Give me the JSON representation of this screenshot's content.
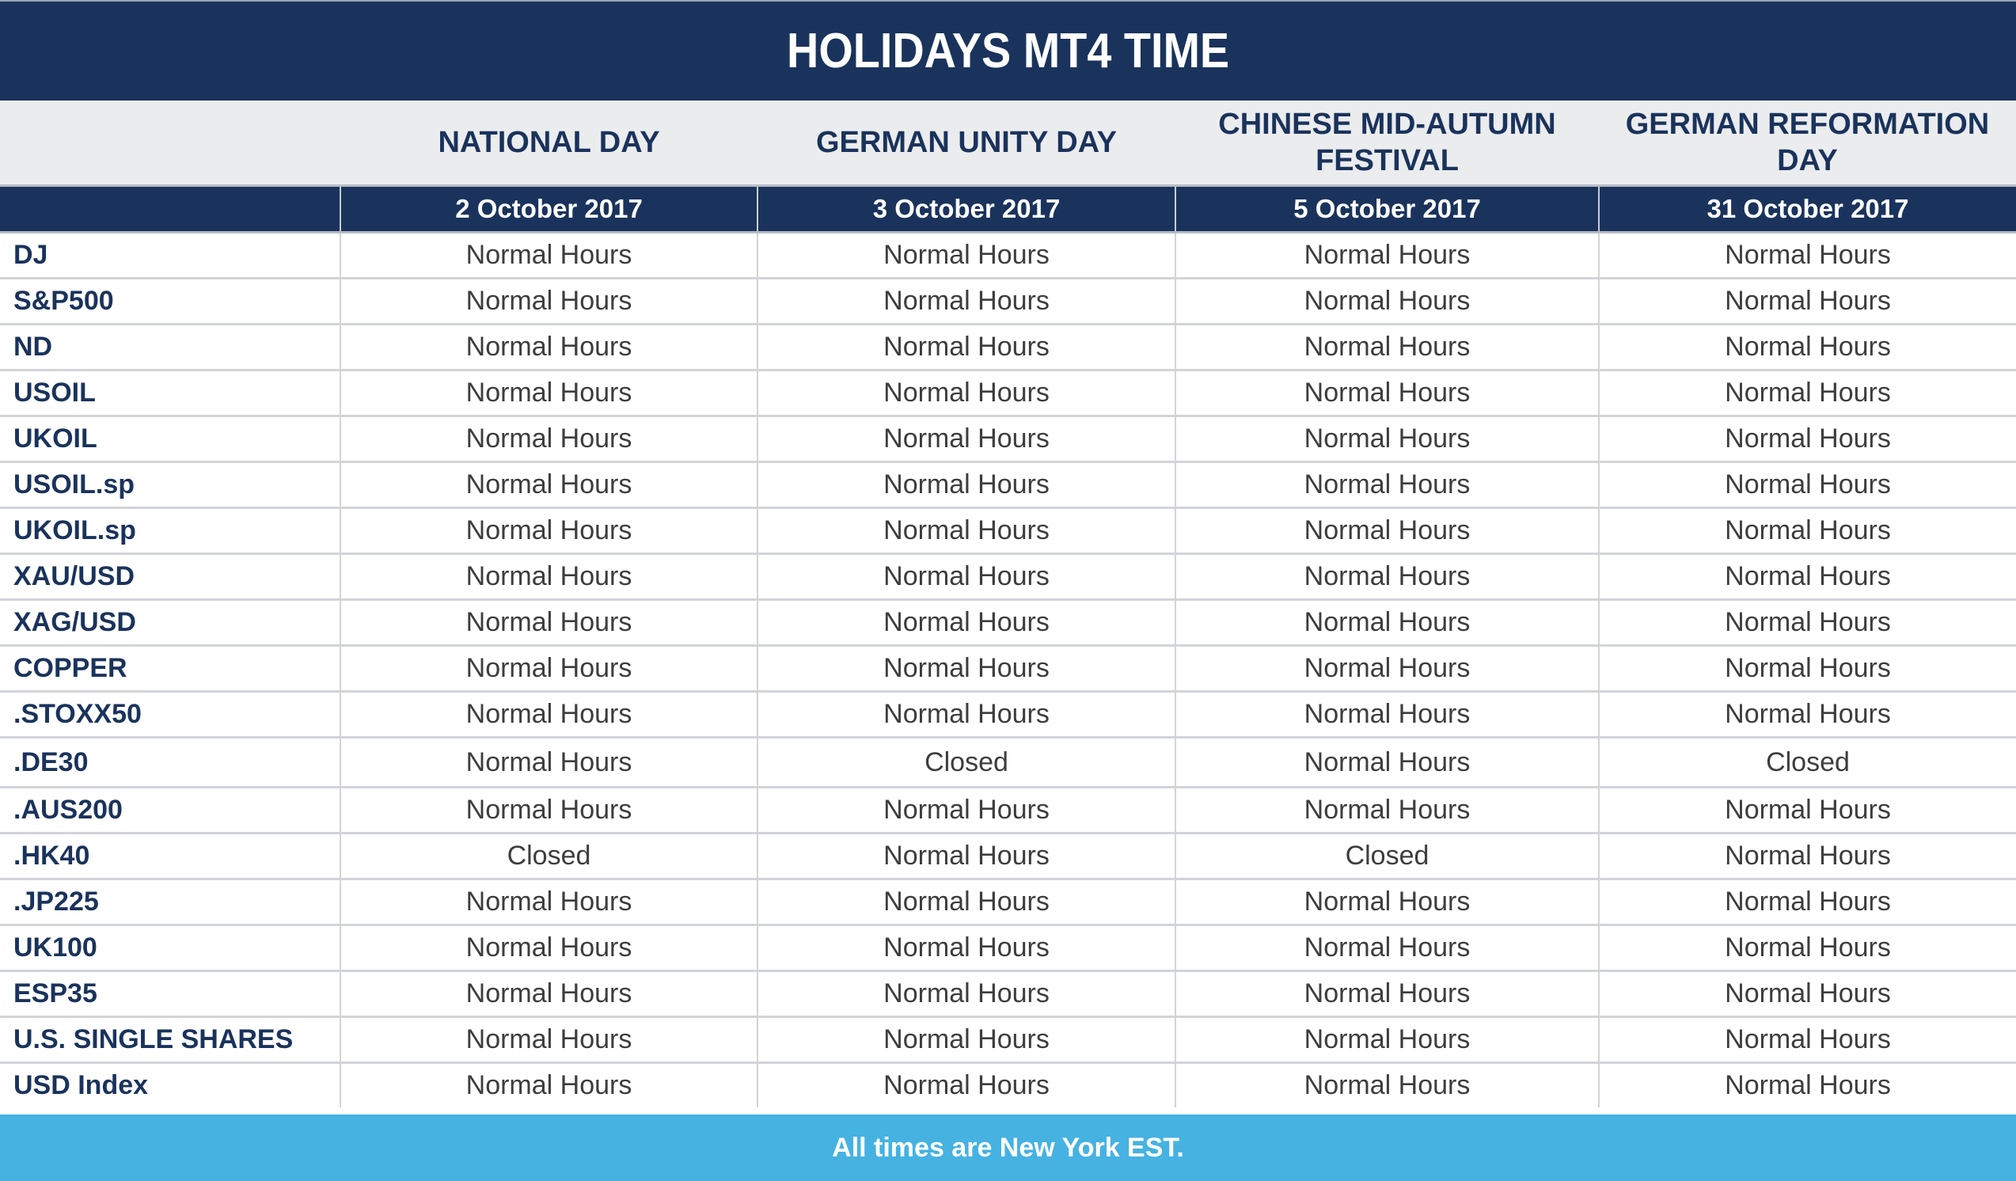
{
  "title": "HOLIDAYS MT4 TIME",
  "columns": [
    {
      "holiday": "NATIONAL DAY",
      "date": "2 October 2017"
    },
    {
      "holiday": "GERMAN UNITY DAY",
      "date": "3 October 2017"
    },
    {
      "holiday": "CHINESE MID-AUTUMN FESTIVAL",
      "date": "5 October 2017"
    },
    {
      "holiday": "GERMAN REFORMATION DAY",
      "date": "31 October 2017"
    }
  ],
  "rows": [
    {
      "instrument": "DJ",
      "values": [
        "Normal Hours",
        "Normal Hours",
        "Normal Hours",
        "Normal Hours"
      ]
    },
    {
      "instrument": "S&P500",
      "values": [
        "Normal Hours",
        "Normal Hours",
        "Normal Hours",
        "Normal Hours"
      ]
    },
    {
      "instrument": "ND",
      "values": [
        "Normal Hours",
        "Normal Hours",
        "Normal Hours",
        "Normal Hours"
      ]
    },
    {
      "instrument": "USOIL",
      "values": [
        "Normal Hours",
        "Normal Hours",
        "Normal Hours",
        "Normal Hours"
      ]
    },
    {
      "instrument": "UKOIL",
      "values": [
        "Normal Hours",
        "Normal Hours",
        "Normal Hours",
        "Normal Hours"
      ]
    },
    {
      "instrument": "USOIL.sp",
      "values": [
        "Normal Hours",
        "Normal Hours",
        "Normal Hours",
        "Normal Hours"
      ]
    },
    {
      "instrument": "UKOIL.sp",
      "values": [
        "Normal Hours",
        "Normal Hours",
        "Normal Hours",
        "Normal Hours"
      ]
    },
    {
      "instrument": "XAU/USD",
      "values": [
        "Normal Hours",
        "Normal Hours",
        "Normal Hours",
        "Normal Hours"
      ]
    },
    {
      "instrument": "XAG/USD",
      "values": [
        "Normal Hours",
        "Normal Hours",
        "Normal Hours",
        "Normal Hours"
      ]
    },
    {
      "instrument": "COPPER",
      "values": [
        "Normal Hours",
        "Normal Hours",
        "Normal Hours",
        "Normal Hours"
      ]
    },
    {
      "instrument": ".STOXX50",
      "values": [
        "Normal Hours",
        "Normal Hours",
        "Normal Hours",
        "Normal Hours"
      ]
    },
    {
      "instrument": ".DE30",
      "values": [
        "Normal Hours",
        "Closed",
        "Normal Hours",
        "Closed"
      ]
    },
    {
      "instrument": ".AUS200",
      "values": [
        "Normal Hours",
        "Normal Hours",
        "Normal Hours",
        "Normal Hours"
      ]
    },
    {
      "instrument": ".HK40",
      "values": [
        "Closed",
        "Normal Hours",
        "Closed",
        "Normal Hours"
      ]
    },
    {
      "instrument": ".JP225",
      "values": [
        "Normal Hours",
        "Normal Hours",
        "Normal Hours",
        "Normal Hours"
      ]
    },
    {
      "instrument": "UK100",
      "values": [
        "Normal Hours",
        "Normal Hours",
        "Normal Hours",
        "Normal Hours"
      ]
    },
    {
      "instrument": "ESP35",
      "values": [
        "Normal Hours",
        "Normal Hours",
        "Normal Hours",
        "Normal Hours"
      ]
    },
    {
      "instrument": "U.S. SINGLE SHARES",
      "values": [
        "Normal Hours",
        "Normal Hours",
        "Normal Hours",
        "Normal Hours"
      ]
    },
    {
      "instrument": "USD Index",
      "values": [
        "Normal Hours",
        "Normal Hours",
        "Normal Hours",
        "Normal Hours"
      ]
    }
  ],
  "footer": "All times are New York EST.",
  "colors": {
    "navy": "#1a335c",
    "header_gray": "#ebecee",
    "footer_blue": "#45b2e1",
    "cell_text": "#3d3d3d"
  }
}
